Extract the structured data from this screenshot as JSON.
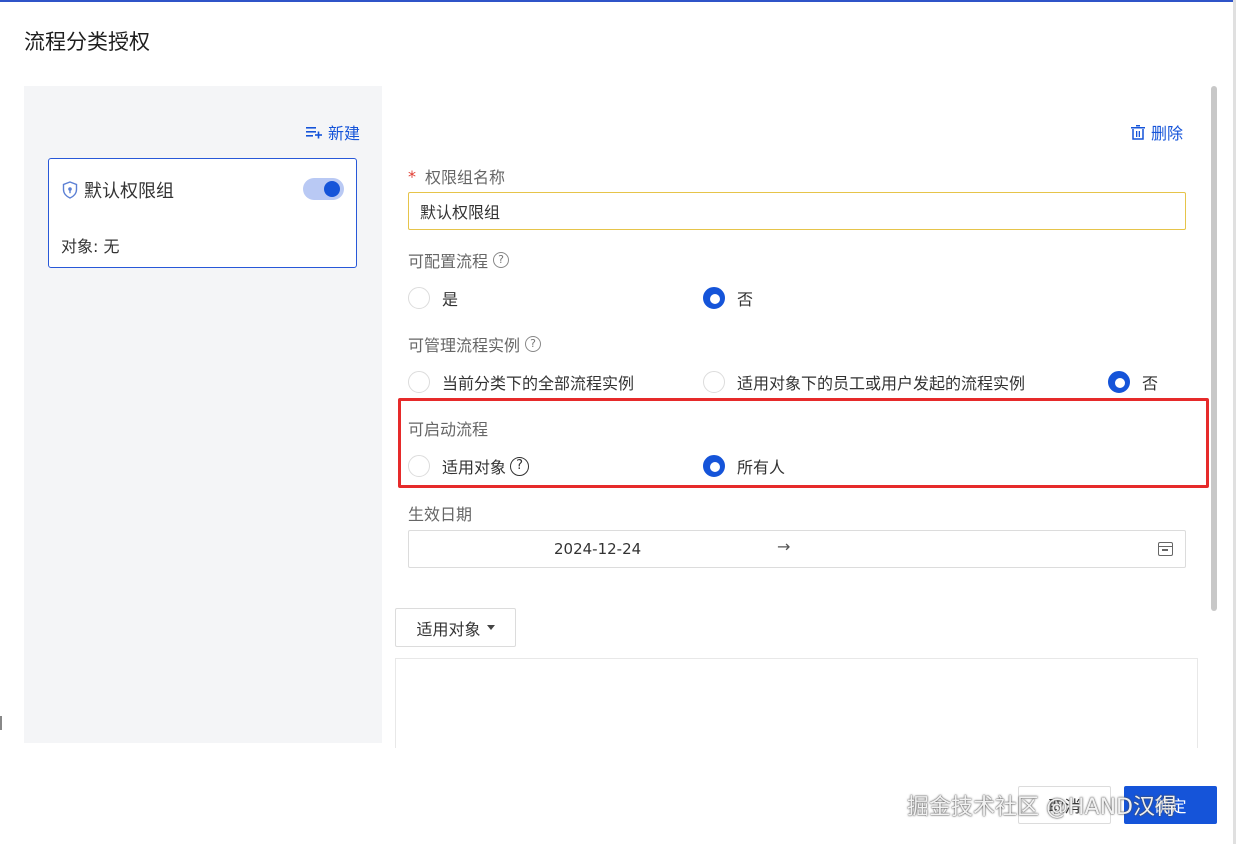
{
  "dialog": {
    "title": "流程分类授权"
  },
  "left_panel": {
    "new_label": "新建",
    "groups": [
      {
        "name": "默认权限组",
        "subtitle": "对象: 无",
        "enabled": true
      }
    ]
  },
  "form": {
    "delete_label": "删除",
    "name_field": {
      "label": "权限组名称",
      "required_mark": "*",
      "value": "默认权限组"
    },
    "configurable": {
      "label": "可配置流程",
      "options": [
        "是",
        "否"
      ],
      "selected": "否"
    },
    "manageable": {
      "label": "可管理流程实例",
      "options": [
        "当前分类下的全部流程实例",
        "适用对象下的员工或用户发起的流程实例",
        "否"
      ],
      "selected": "否"
    },
    "startable": {
      "label": "可启动流程",
      "options": [
        "适用对象",
        "所有人"
      ],
      "selected": "所有人"
    },
    "effective_date": {
      "label": "生效日期",
      "start": "2024-12-24",
      "separator": "→",
      "end": ""
    },
    "target_dropdown": {
      "label": "适用对象"
    }
  },
  "footer": {
    "cancel_label": "取消",
    "ok_label": "确定"
  },
  "watermark": {
    "text": "掘金技术社区 @HAND汉得"
  },
  "icons": {
    "new": "list-add-icon",
    "delete": "trash-icon",
    "shield": "shield-icon",
    "help": "question-circle-icon",
    "calendar": "calendar-icon",
    "caret": "caret-down-icon"
  },
  "colors": {
    "accent": "#1554d9",
    "highlight": "#e62a2a",
    "input_focus": "#e6c44a",
    "panel_bg": "#f4f5f7"
  }
}
